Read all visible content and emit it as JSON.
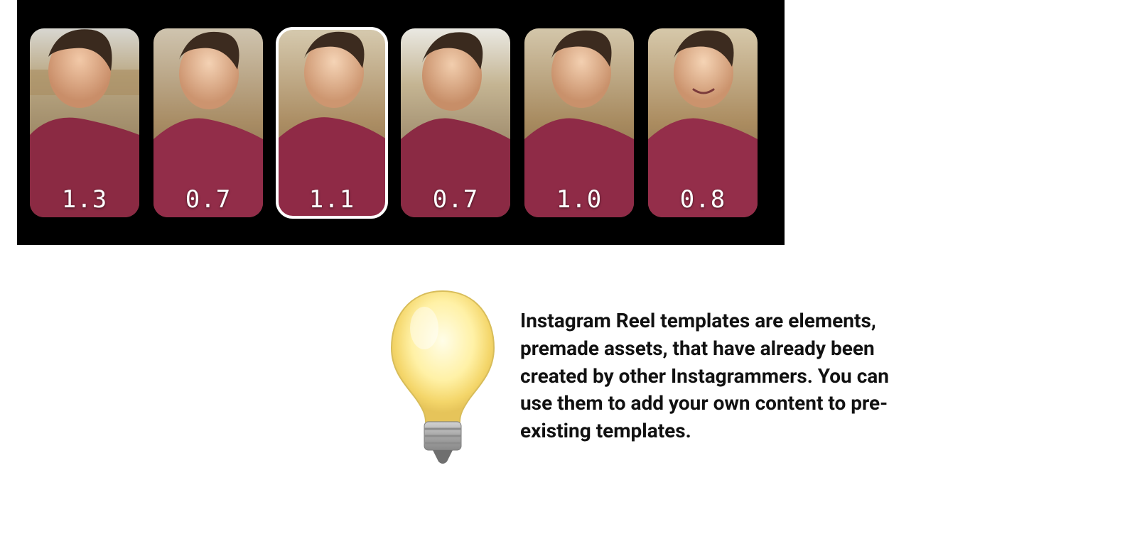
{
  "clips": [
    {
      "duration": "1.3",
      "selected": false
    },
    {
      "duration": "0.7",
      "selected": false
    },
    {
      "duration": "1.1",
      "selected": true
    },
    {
      "duration": "0.7",
      "selected": false
    },
    {
      "duration": "1.0",
      "selected": false
    },
    {
      "duration": "0.8",
      "selected": false
    }
  ],
  "tip": {
    "icon": "lightbulb-icon",
    "text": "Instagram Reel templates are elements, premade assets, that have already been created by other Instagrammers. You can use them to add your own content to pre-existing templates."
  }
}
